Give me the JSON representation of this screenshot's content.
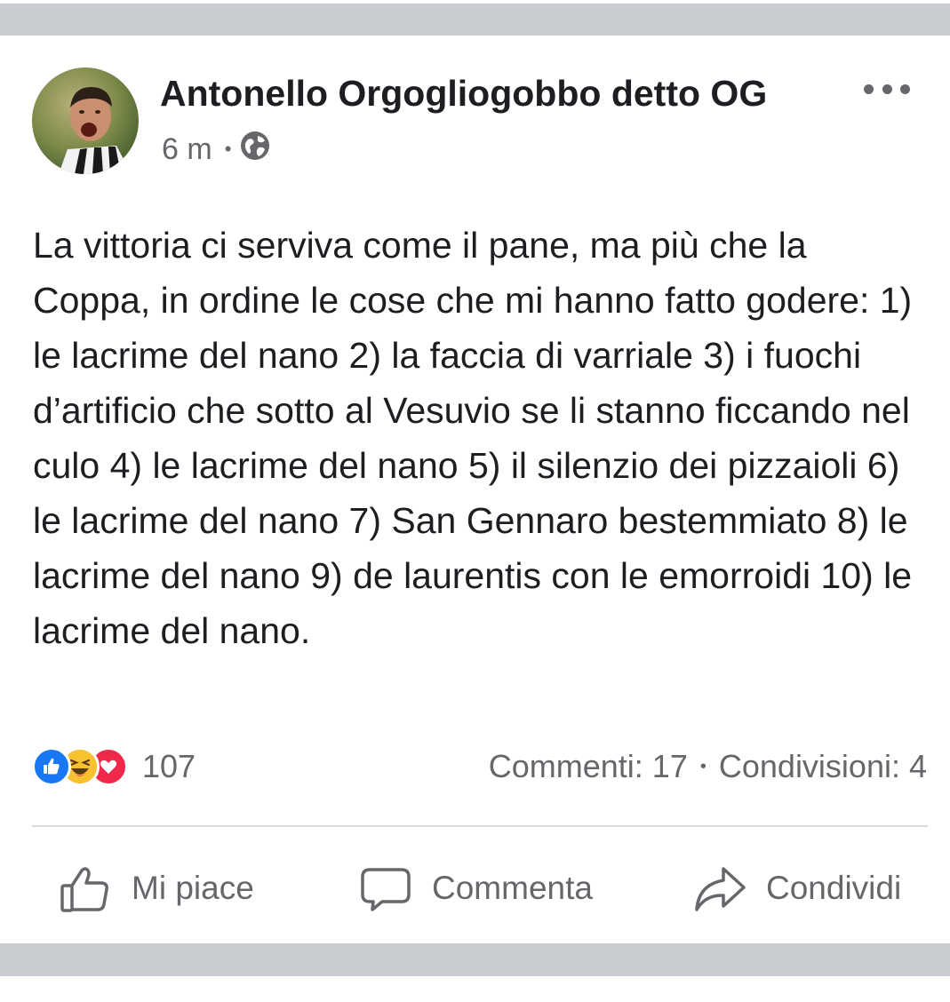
{
  "post": {
    "author": "Antonello Orgogliogobbo detto OG",
    "time": "6 m",
    "separator": "•",
    "privacy_icon": "globe-icon",
    "more_icon": "more-options-icon",
    "text": "La vittoria ci serviva come il pane, ma più che la Coppa, in ordine le cose che mi hanno fatto godere: 1) le lacrime del nano 2) la faccia di varriale 3) i fuochi d’artificio che sotto al Vesuvio se li stanno ficcando nel culo 4) le lacrime del nano 5) il silenzio dei pizzaioli 6) le lacrime del nano 7) San Gennaro bestemmiato 8) le lacrime del nano 9) de laurentis con le emorroidi 10) le lacrime del nano."
  },
  "reactions": {
    "icons": [
      "like-reaction-icon",
      "haha-reaction-icon",
      "love-reaction-icon"
    ],
    "count": "107"
  },
  "stats": {
    "comments": "Commenti: 17",
    "separator": "•",
    "shares": "Condivisioni: 4"
  },
  "actions": {
    "like": "Mi piace",
    "comment": "Commenta",
    "share": "Condividi"
  },
  "colors": {
    "band": "#c9ccd1",
    "text": "#1c1e21",
    "secondary": "#65676b",
    "like_blue": "#1877f2",
    "haha_yellow": "#f7b125",
    "love_red": "#f0284a"
  }
}
